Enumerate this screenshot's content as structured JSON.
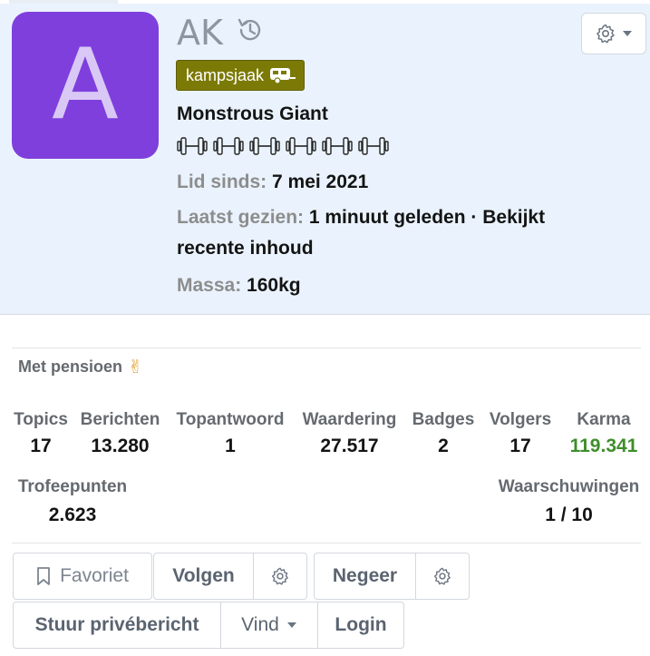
{
  "profile": {
    "avatar_letter": "A",
    "username": "AK",
    "banner": "kampsjaak",
    "rank_title": "Monstrous Giant",
    "member_since_label": "Lid sinds:",
    "member_since_value": "7 mei 2021",
    "last_seen_label": "Laatst gezien:",
    "last_seen_value": "1 minuut geleden · Bekijkt recente inhoud",
    "mass_label": "Massa:",
    "mass_value": "160kg",
    "custom_title": "Met pensioen",
    "custom_title_emoji": "✌",
    "dumbbell_count": 6
  },
  "stats": [
    {
      "label": "Topics",
      "value": "17"
    },
    {
      "label": "Berichten",
      "value": "13.280"
    },
    {
      "label": "Topantwoord",
      "value": "1"
    },
    {
      "label": "Waardering",
      "value": "27.517"
    },
    {
      "label": "Badges",
      "value": "2"
    },
    {
      "label": "Volgers",
      "value": "17"
    },
    {
      "label": "Karma",
      "value": "119.341"
    }
  ],
  "trophy": {
    "label": "Trofeepunten",
    "value": "2.623"
  },
  "warnings": {
    "label": "Waarschuwingen",
    "value": "1 / 10"
  },
  "actions": {
    "favorite": "Favoriet",
    "follow": "Volgen",
    "ignore": "Negeer",
    "message": "Stuur privébericht",
    "find": "Vind",
    "login": "Login"
  },
  "colors": {
    "avatar_bg": "#7f3fdd",
    "banner_bg": "#7c7a06",
    "header_bg": "#eaf3fd",
    "karma": "#3e8e2a"
  }
}
